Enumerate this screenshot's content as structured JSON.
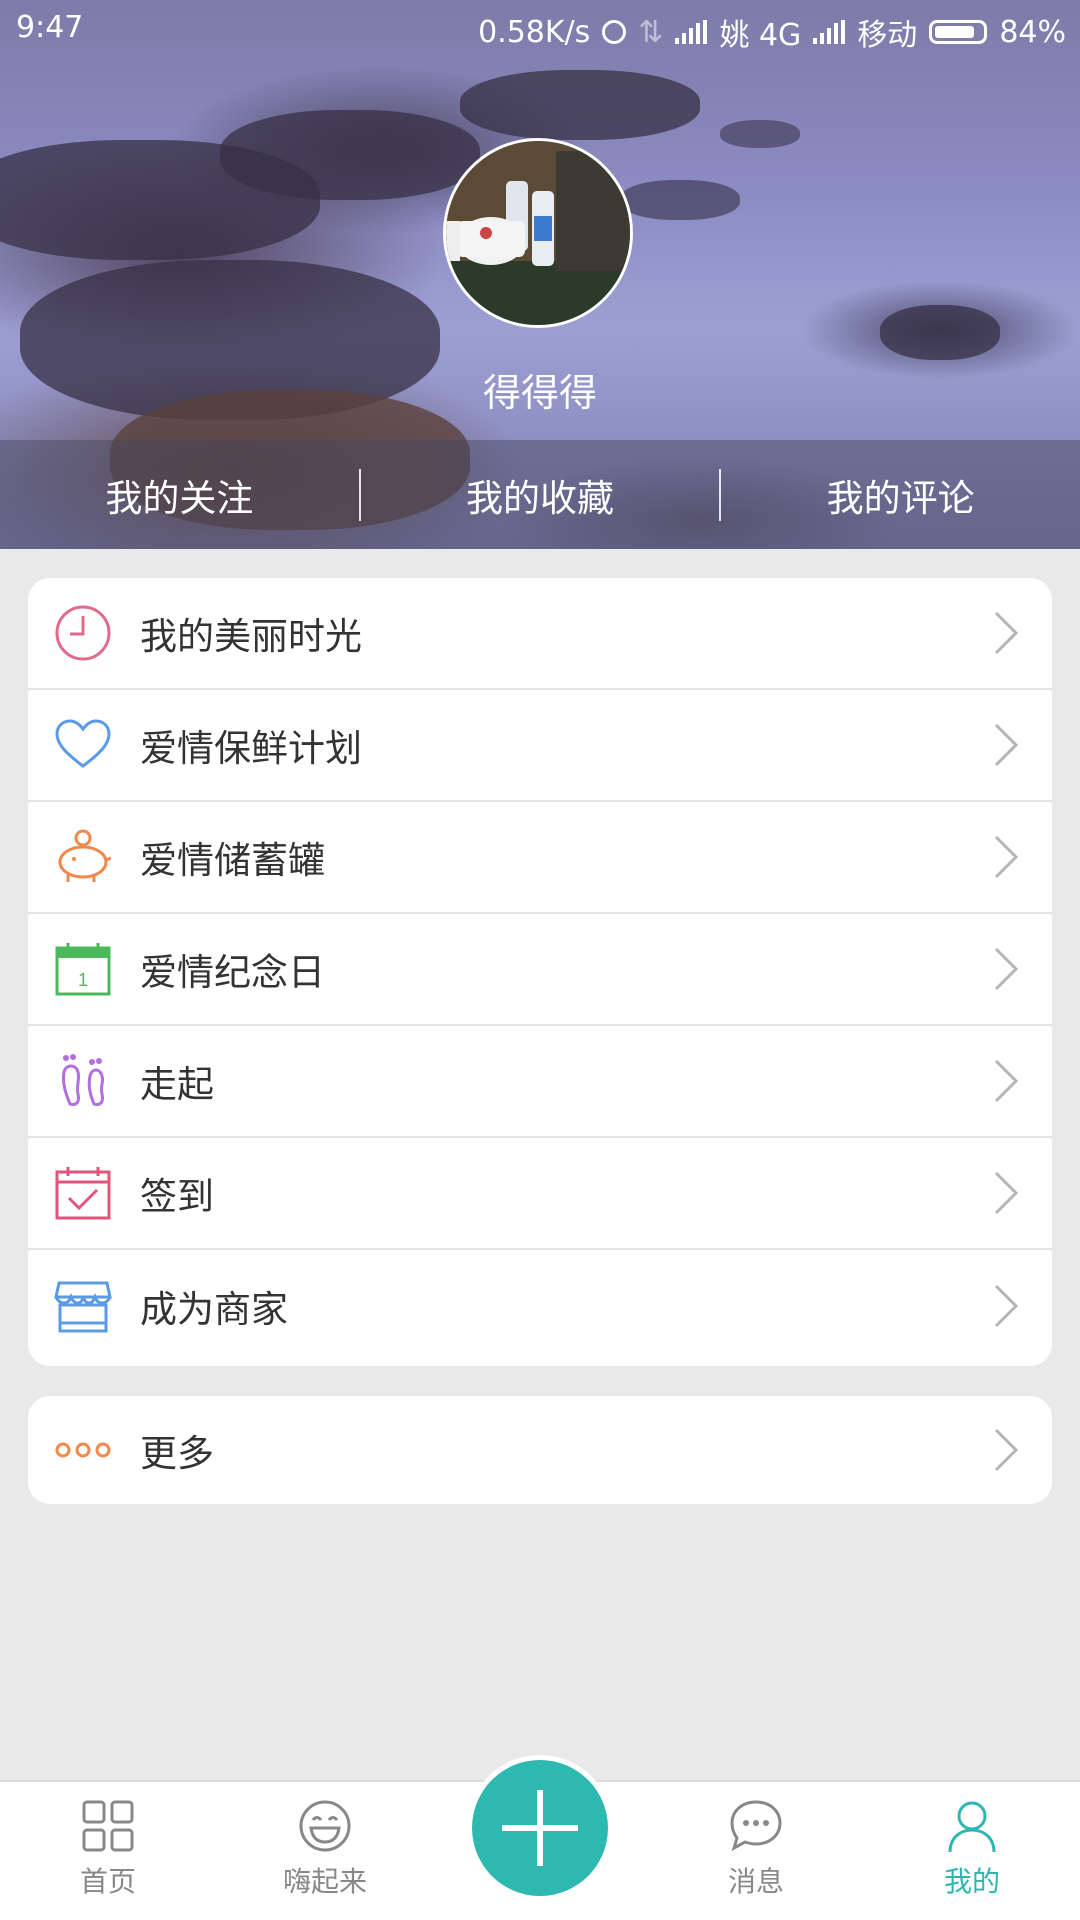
{
  "status_bar": {
    "time": "9:47",
    "speed": "0.58K/s",
    "carrier1": "姚 4G",
    "carrier2": "移动",
    "battery": "84%",
    "battery_level": 0.84
  },
  "profile": {
    "nickname": "得得得"
  },
  "header_tabs": [
    {
      "label": "我的关注"
    },
    {
      "label": "我的收藏"
    },
    {
      "label": "我的评论"
    }
  ],
  "menu": [
    {
      "label": "我的美丽时光",
      "icon": "clock-icon",
      "color": "#e46a8a"
    },
    {
      "label": "爱情保鲜计划",
      "icon": "heart-icon",
      "color": "#5b9be6"
    },
    {
      "label": "爱情储蓄罐",
      "icon": "piggy-bank-icon",
      "color": "#f08a4b"
    },
    {
      "label": "爱情纪念日",
      "icon": "calendar-icon",
      "color": "#4cb85c"
    },
    {
      "label": "走起",
      "icon": "footprints-icon",
      "color": "#b36ee0"
    },
    {
      "label": "签到",
      "icon": "checkin-calendar-icon",
      "color": "#e2557a"
    },
    {
      "label": "成为商家",
      "icon": "store-icon",
      "color": "#5b9be6"
    }
  ],
  "more": {
    "label": "更多",
    "icon": "more-dots-icon",
    "color": "#f08a4b"
  },
  "calendar_icon_day": "1",
  "bottom_nav": [
    {
      "label": "首页",
      "icon": "grid-icon"
    },
    {
      "label": "嗨起来",
      "icon": "smile-icon"
    },
    {
      "label": "消息",
      "icon": "chat-icon"
    },
    {
      "label": "我的",
      "icon": "person-icon",
      "active": true
    }
  ],
  "accent_color": "#2db8b0"
}
